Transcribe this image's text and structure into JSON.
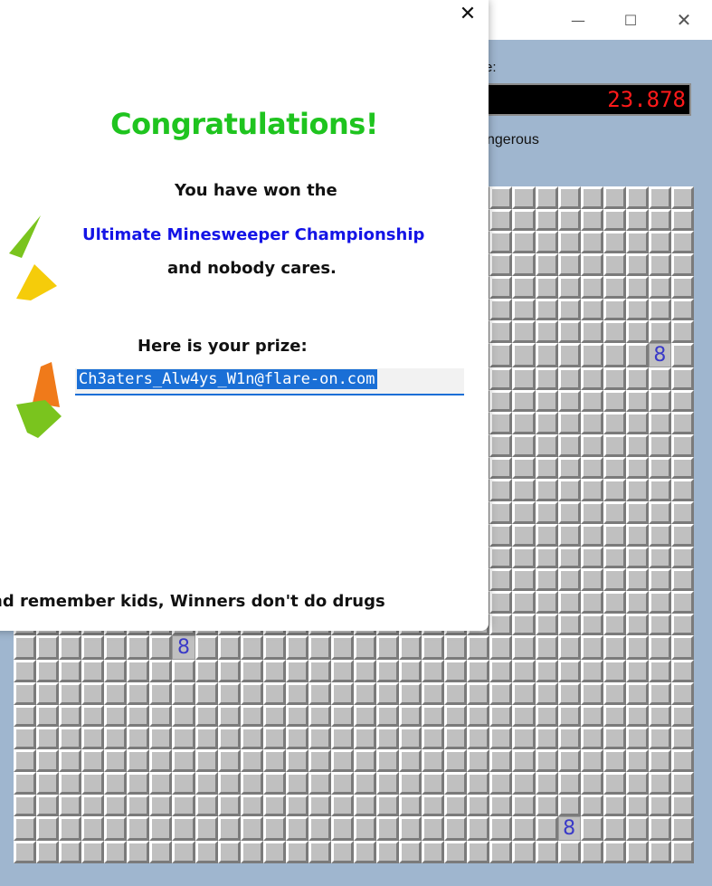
{
  "game": {
    "time_label": "e:",
    "time_value": "23.878",
    "difficulty_label": "ngerous",
    "board": {
      "rows": 30,
      "cols": 30,
      "revealed_cells": [
        {
          "row": 7,
          "col": 28,
          "value": "8"
        },
        {
          "row": 20,
          "col": 7,
          "value": "8"
        },
        {
          "row": 28,
          "col": 24,
          "value": "8"
        }
      ]
    },
    "window_controls": {
      "minimize": "—",
      "maximize": "☐",
      "close": "✕"
    }
  },
  "dialog": {
    "close_label": "✕",
    "title": "Congratulations!",
    "line1": "You have won the",
    "championship": "Ultimate Minesweeper Championship",
    "line3": "and nobody cares.",
    "prize_label": "Here is your prize:",
    "prize_value": "Ch3aters_Alw4ys_W1n@flare-on.com",
    "footer": "nd remember kids, Winners don't do drugs"
  },
  "colors": {
    "title": "#1fc41f",
    "championship": "#1414e6",
    "timer_text": "#ff1a1a",
    "board_number": "#3a3ac8",
    "window_bg": "#9fb6cf",
    "selection": "#1a6fd6"
  }
}
